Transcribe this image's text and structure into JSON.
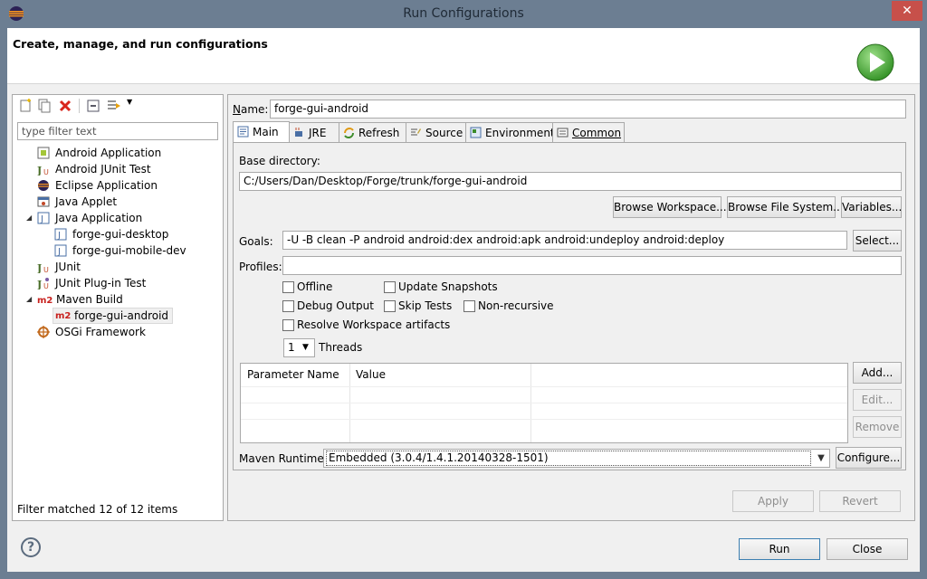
{
  "window": {
    "title": "Run Configurations",
    "close_glyph": "✕"
  },
  "header": {
    "text": "Create, manage, and run configurations"
  },
  "left": {
    "filter_placeholder": "type filter text",
    "tree": [
      {
        "label": "Android Application",
        "icon": "android-app-icon"
      },
      {
        "label": "Android JUnit Test",
        "icon": "junit-icon"
      },
      {
        "label": "Eclipse Application",
        "icon": "eclipse-icon"
      },
      {
        "label": "Java Applet",
        "icon": "applet-icon"
      },
      {
        "label": "Java Application",
        "icon": "java-app-icon"
      },
      {
        "label": "forge-gui-desktop",
        "icon": "java-config-icon"
      },
      {
        "label": "forge-gui-mobile-dev",
        "icon": "java-config-icon"
      },
      {
        "label": "JUnit",
        "icon": "junit-icon"
      },
      {
        "label": "JUnit Plug-in Test",
        "icon": "junit-plugin-icon"
      },
      {
        "label": "Maven Build",
        "icon": "maven-icon"
      },
      {
        "label": "forge-gui-android",
        "icon": "maven-icon"
      },
      {
        "label": "OSGi Framework",
        "icon": "osgi-icon"
      }
    ],
    "maven_badge": "m2",
    "status": "Filter matched 12 of 12 items"
  },
  "form": {
    "name_label_u": "N",
    "name_label_rest": "ame:",
    "name_value": "forge-gui-android",
    "tabs": [
      {
        "label": "Main"
      },
      {
        "label": "JRE"
      },
      {
        "label": "Refresh"
      },
      {
        "label": "Source"
      },
      {
        "label": "Environment"
      },
      {
        "label": "Common"
      }
    ],
    "base_dir_label": "Base directory:",
    "base_dir_value": "C:/Users/Dan/Desktop/Forge/trunk/forge-gui-android",
    "browse_workspace": "Browse Workspace...",
    "browse_fs": "Browse File System...",
    "variables": "Variables...",
    "goals_label": "Goals:",
    "goals_value": "-U -B clean -P android android:dex android:apk android:undeploy android:deploy",
    "select_btn": "Select...",
    "profiles_label": "Profiles:",
    "profiles_value": "",
    "checkboxes": {
      "offline": "Offline",
      "update_snapshots": "Update Snapshots",
      "debug_output": "Debug Output",
      "skip_tests": "Skip Tests",
      "non_recursive": "Non-recursive",
      "resolve_ws": "Resolve Workspace artifacts"
    },
    "threads_value": "1",
    "threads_label": "Threads",
    "params_columns": [
      "Parameter Name",
      "Value"
    ],
    "add_btn": "Add...",
    "edit_btn": "Edit...",
    "remove_btn": "Remove",
    "runtime_label": "Maven Runtime:",
    "runtime_value": "Embedded (3.0.4/1.4.1.20140328-1501)",
    "configure_btn": "Configure...",
    "apply_btn": "Apply",
    "revert_btn": "Revert"
  },
  "footer": {
    "run_btn": "Run",
    "close_btn": "Close",
    "help_glyph": "?"
  }
}
